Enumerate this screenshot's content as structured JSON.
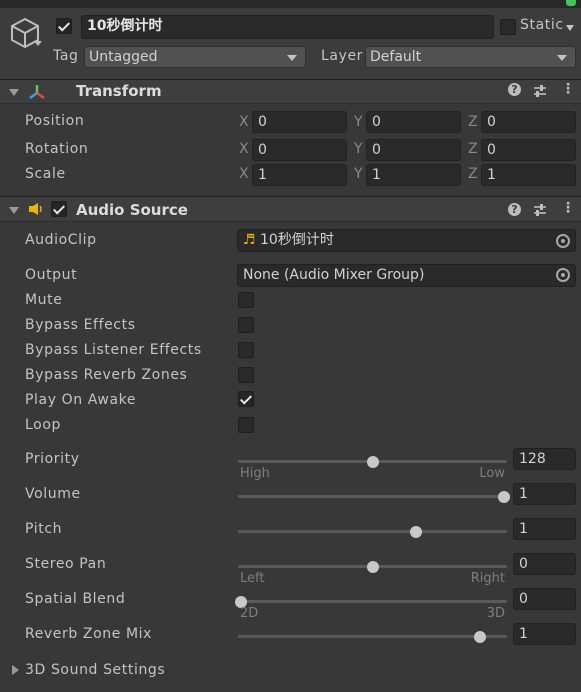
{
  "header": {
    "object_name": "10秒倒计时",
    "static_label": "Static",
    "tag_label": "Tag",
    "tag_value": "Untagged",
    "layer_label": "Layer",
    "layer_value": "Default",
    "active": true
  },
  "transform": {
    "title": "Transform",
    "rows": [
      {
        "label": "Position",
        "x": "0",
        "y": "0",
        "z": "0"
      },
      {
        "label": "Rotation",
        "x": "0",
        "y": "0",
        "z": "0"
      },
      {
        "label": "Scale",
        "x": "1",
        "y": "1",
        "z": "1"
      }
    ],
    "axes": [
      "X",
      "Y",
      "Z"
    ]
  },
  "audio_source": {
    "title": "Audio Source",
    "enabled": true,
    "audioclip_label": "AudioClip",
    "audioclip_value": "10秒倒计时",
    "output_label": "Output",
    "output_value": "None (Audio Mixer Group)",
    "toggles": [
      {
        "label": "Mute",
        "checked": false
      },
      {
        "label": "Bypass Effects",
        "checked": false
      },
      {
        "label": "Bypass Listener Effects",
        "checked": false
      },
      {
        "label": "Bypass Reverb Zones",
        "checked": false
      },
      {
        "label": "Play On Awake",
        "checked": true
      },
      {
        "label": "Loop",
        "checked": false
      }
    ],
    "sliders": [
      {
        "label": "Priority",
        "value": "128",
        "fraction": 0.5,
        "min_label": "High",
        "max_label": "Low"
      },
      {
        "label": "Volume",
        "value": "1",
        "fraction": 1.0,
        "min_label": "",
        "max_label": ""
      },
      {
        "label": "Pitch",
        "value": "1",
        "fraction": 0.667,
        "min_label": "",
        "max_label": ""
      },
      {
        "label": "Stereo Pan",
        "value": "0",
        "fraction": 0.5,
        "min_label": "Left",
        "max_label": "Right"
      },
      {
        "label": "Spatial Blend",
        "value": "0",
        "fraction": 0.0,
        "min_label": "2D",
        "max_label": "3D"
      },
      {
        "label": "Reverb Zone Mix",
        "value": "1",
        "fraction": 0.909,
        "min_label": "",
        "max_label": ""
      }
    ],
    "sound_settings_label": "3D Sound Settings"
  },
  "colors": {
    "accent_green": "#3fc55a",
    "audio_icon": "#f0b400"
  },
  "icons": [
    "gameobject-cube-icon",
    "transform-axes-icon",
    "speaker-icon",
    "help-icon",
    "presets-icon",
    "kebab-menu-icon",
    "audio-note-icon",
    "object-picker-icon"
  ]
}
